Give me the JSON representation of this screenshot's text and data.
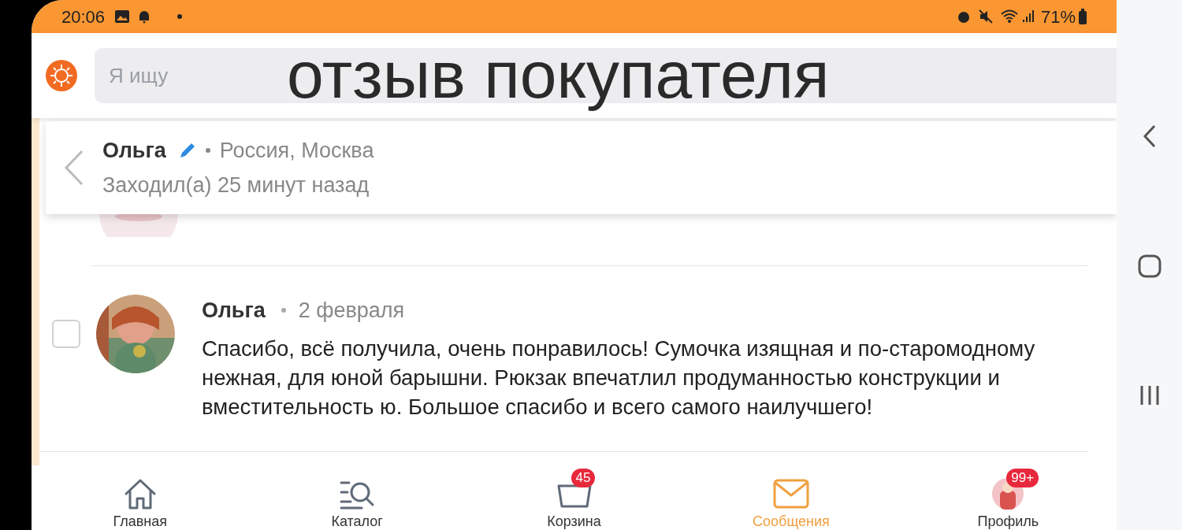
{
  "status_bar": {
    "time": "20:06",
    "battery": "71%"
  },
  "header": {
    "search": {
      "placeholder": "Я ищу"
    },
    "caption": "отзыв покупателя"
  },
  "contact": {
    "name": "Ольга",
    "location": "Россия, Москва",
    "last_seen": "Заходил(а) 25 минут назад"
  },
  "messages": [
    {
      "author": "Ольга",
      "date": "2 февраля",
      "text": "Спасибо, всё получила, очень понравилось! Сумочка изящная и по-старомодному нежная, для юной барышни. Рюкзак впечатлил продуманностью конструкции и вместительность ю. Большое спасибо и всего самого наилучшего!",
      "checked": false
    }
  ],
  "bottom_nav": [
    {
      "kind": "home",
      "label": "Главная",
      "selected": false
    },
    {
      "kind": "catalog",
      "label": "Каталог",
      "selected": false
    },
    {
      "kind": "cart",
      "label": "Корзина",
      "selected": false,
      "badge": "45"
    },
    {
      "kind": "messages",
      "label": "Сообщения",
      "selected": true
    },
    {
      "kind": "profile",
      "label": "Профиль",
      "selected": false,
      "badge": "99+"
    }
  ]
}
